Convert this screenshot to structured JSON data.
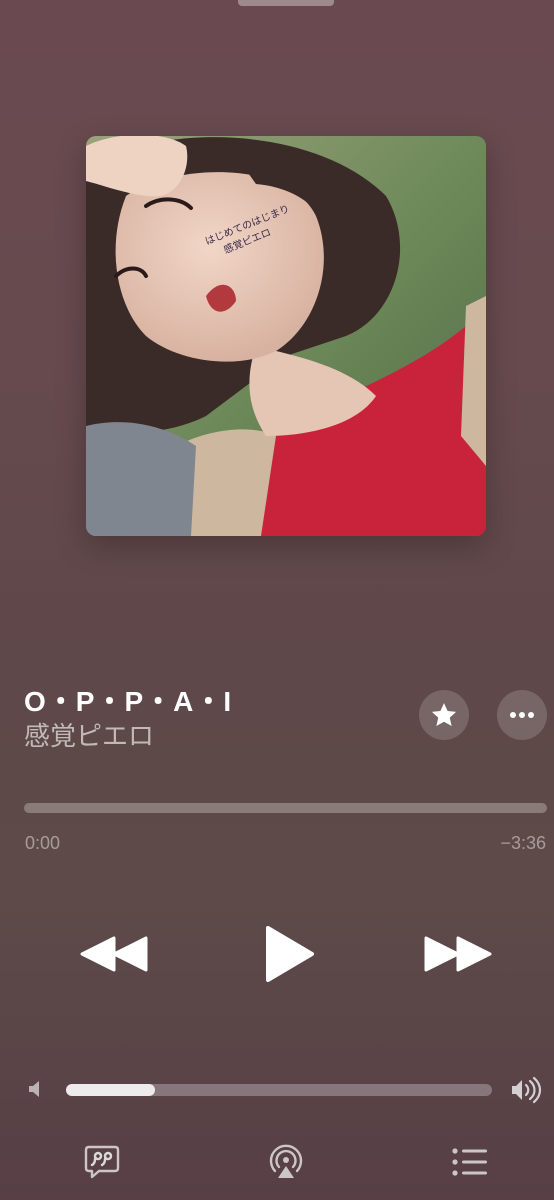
{
  "now_playing": {
    "title": "O・P・P・A・I",
    "artist": "感覚ピエロ",
    "artwork_caption": "はじめてのはじまり 感覚ピエロ"
  },
  "progress": {
    "elapsed": "0:00",
    "remaining": "−3:36",
    "fraction": 0.0
  },
  "volume": {
    "fraction": 0.21
  },
  "controls": {
    "favorite_icon": "star-icon",
    "more_icon": "ellipsis-icon",
    "rewind_icon": "backward-icon",
    "play_icon": "play-icon",
    "forward_icon": "forward-icon",
    "lyrics_icon": "lyrics-quote-icon",
    "airplay_icon": "airplay-icon",
    "queue_icon": "list-icon"
  },
  "colors": {
    "background_top": "#6a4a50",
    "background_bottom": "#573f45",
    "foreground": "#ffffff"
  }
}
